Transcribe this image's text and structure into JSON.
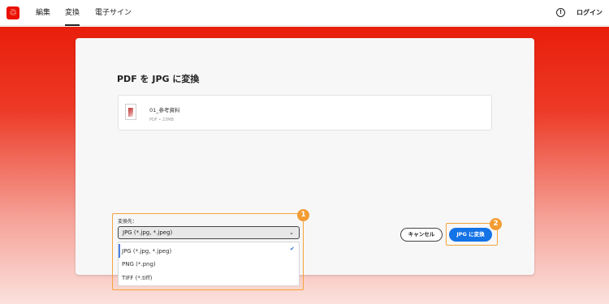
{
  "header": {
    "tabs": [
      {
        "label": "編集"
      },
      {
        "label": "変換",
        "active": true
      },
      {
        "label": "電子サイン"
      }
    ],
    "help_icon": "help-circle-icon",
    "login_label": "ログイン",
    "logo_icon": "acrobat-logo-icon"
  },
  "main": {
    "title": "PDF を JPG に変換",
    "file": {
      "name": "01_参考資料",
      "meta": "PDF • 23MB"
    },
    "destination": {
      "label": "変換先：",
      "selected": "JPG (*.jpg, *.jpeg)",
      "options": [
        {
          "label": "JPG (*.jpg, *.jpeg)",
          "checked": true
        },
        {
          "label": "PNG (*.png)"
        },
        {
          "label": "TIFF (*.tiff)"
        }
      ]
    },
    "cancel_label": "キャンセル",
    "convert_label": "JPG に変換"
  },
  "annotations": {
    "badge1": "1",
    "badge2": "2"
  },
  "colors": {
    "brand_red": "#eb1000",
    "accent_blue": "#1473e6",
    "highlight_orange": "#f39c33"
  }
}
